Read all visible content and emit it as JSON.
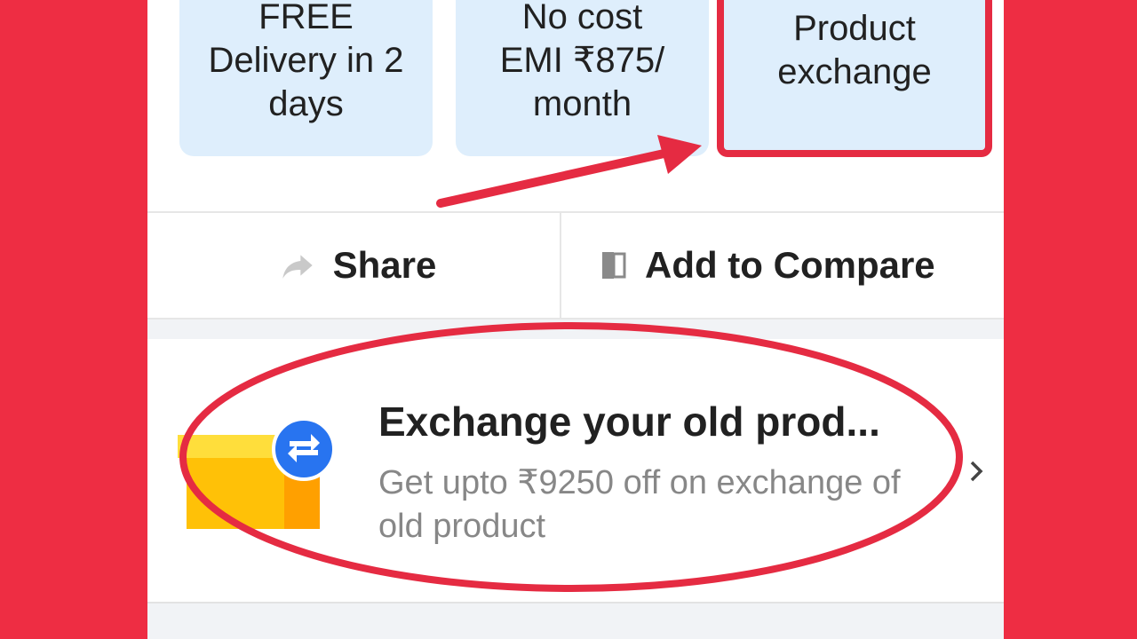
{
  "benefits": [
    {
      "lines": [
        "FREE",
        "Delivery in 2",
        "days"
      ]
    },
    {
      "lines": [
        "No cost",
        "EMI ₹875/",
        "month"
      ]
    },
    {
      "lines": [
        "Product",
        "exchange"
      ]
    }
  ],
  "actions": {
    "share_label": "Share",
    "compare_label": "Add to Compare"
  },
  "exchange": {
    "title": "Exchange your old prod...",
    "subtitle": "Get upto ₹9250 off on exchange of old product"
  },
  "colors": {
    "background_red": "#ee2d43",
    "annotation_red": "#e52b42",
    "card_bg": "#deeefc",
    "brand_blue": "#2874f0",
    "box_yellow": "#ffc107"
  },
  "icons": {
    "share": "share-arrow-icon",
    "compare": "compare-icon",
    "swap": "swap-arrows-icon",
    "chevron": "chevron-right-icon"
  }
}
